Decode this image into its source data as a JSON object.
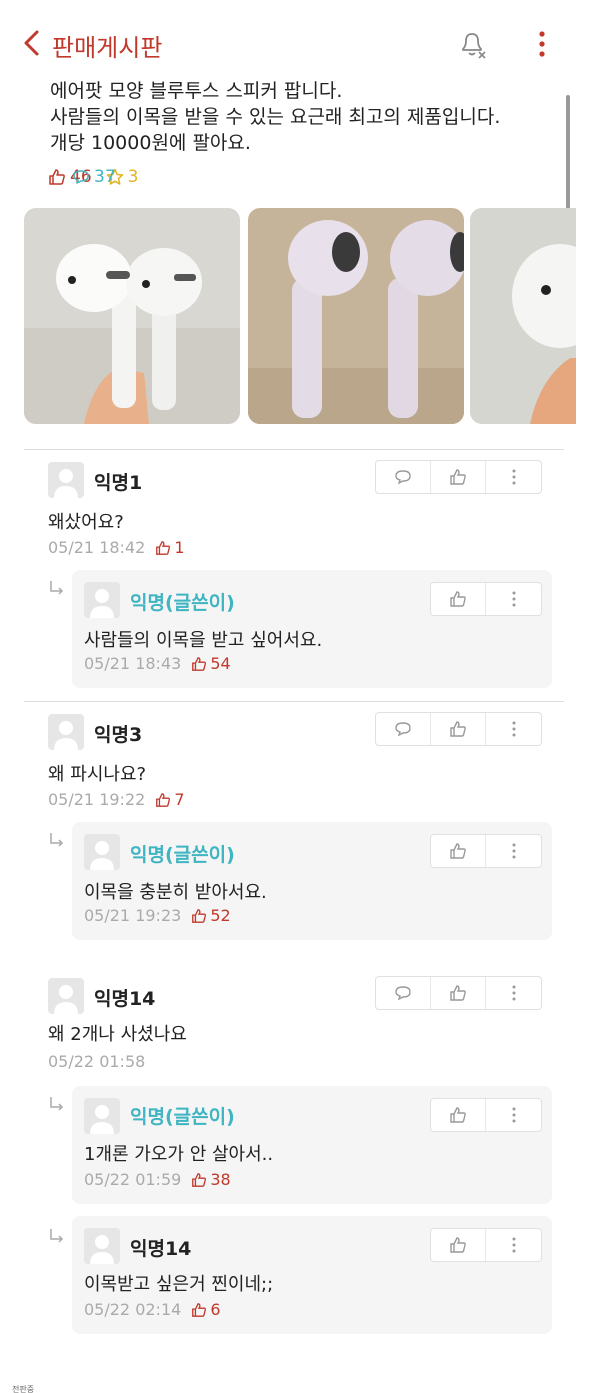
{
  "header": {
    "title": "판매게시판"
  },
  "post": {
    "lines": [
      "에어팟 모양 블루투스 스피커 팝니다.",
      "사람들의 이목을 받을 수 있는 요근래 최고의 제품입니다.",
      "개당 10000원에 팔아요."
    ],
    "likes": "46",
    "comments": "37",
    "scraps": "3"
  },
  "colors": {
    "accent": "#c0392b",
    "author": "#3fb5c2",
    "scrap": "#e2b21f"
  },
  "comments": [
    {
      "name": "익명1",
      "text": "왜샀어요?",
      "time": "05/21 18:42",
      "likes": "1",
      "reply": {
        "name": "익명(글쓴이)",
        "text": "사람들의 이목을 받고 싶어서요.",
        "time": "05/21 18:43",
        "likes": "54"
      }
    },
    {
      "name": "익명3",
      "text": "왜 파시나요?",
      "time": "05/21 19:22",
      "likes": "7",
      "reply": {
        "name": "익명(글쓴이)",
        "text": "이목을 충분히 받아서요.",
        "time": "05/21 19:23",
        "likes": "52"
      }
    },
    {
      "name": "익명14",
      "text": "왜 2개나 사셨나요",
      "time": "05/22 01:58",
      "likes": "",
      "replies": [
        {
          "name": "익명(글쓴이)",
          "text": "1개론 가오가 안 살아서..",
          "time": "05/22 01:59",
          "likes": "38"
        },
        {
          "name": "익명14",
          "text": "이목받고 싶은거 찐이네;;",
          "time": "05/22 02:14",
          "likes": "6"
        }
      ]
    }
  ],
  "watermark": "전판중"
}
